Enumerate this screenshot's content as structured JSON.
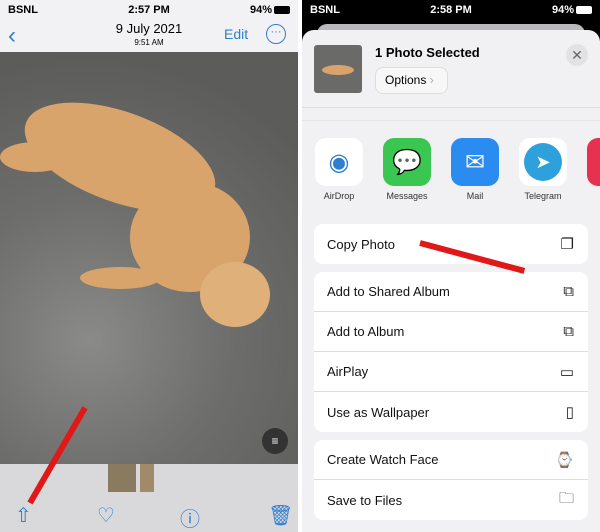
{
  "left": {
    "status": {
      "carrier": "BSNL",
      "time": "2:57 PM",
      "battery": "94%"
    },
    "nav": {
      "back_icon": "chevron-left",
      "date": "9 July 2021",
      "time": "9:51 AM",
      "edit_label": "Edit",
      "more_icon": "ellipsis-circle"
    },
    "toolbar": {
      "share_icon": "share",
      "favorite_icon": "heart",
      "info_icon": "info-sparkle",
      "delete_icon": "trash"
    }
  },
  "right": {
    "status": {
      "carrier": "BSNL",
      "time": "2:58 PM",
      "battery": "94%"
    },
    "header": {
      "title": "1 Photo Selected",
      "options_label": "Options"
    },
    "apps": [
      {
        "label": "AirDrop",
        "color": "#ffffff"
      },
      {
        "label": "Messages",
        "color": "#3ac650"
      },
      {
        "label": "Mail",
        "color": "#2a8cf0"
      },
      {
        "label": "Telegram",
        "color": "#ffffff"
      }
    ],
    "actions": [
      [
        {
          "label": "Copy Photo",
          "icon": "copy"
        }
      ],
      [
        {
          "label": "Add to Shared Album",
          "icon": "shared-album"
        },
        {
          "label": "Add to Album",
          "icon": "add-album"
        },
        {
          "label": "AirPlay",
          "icon": "airplay"
        },
        {
          "label": "Use as Wallpaper",
          "icon": "phone"
        }
      ],
      [
        {
          "label": "Create Watch Face",
          "icon": "watch"
        },
        {
          "label": "Save to Files",
          "icon": "folder"
        }
      ]
    ]
  },
  "accent": "#2f7fd1",
  "annotation_color": "#e01818"
}
